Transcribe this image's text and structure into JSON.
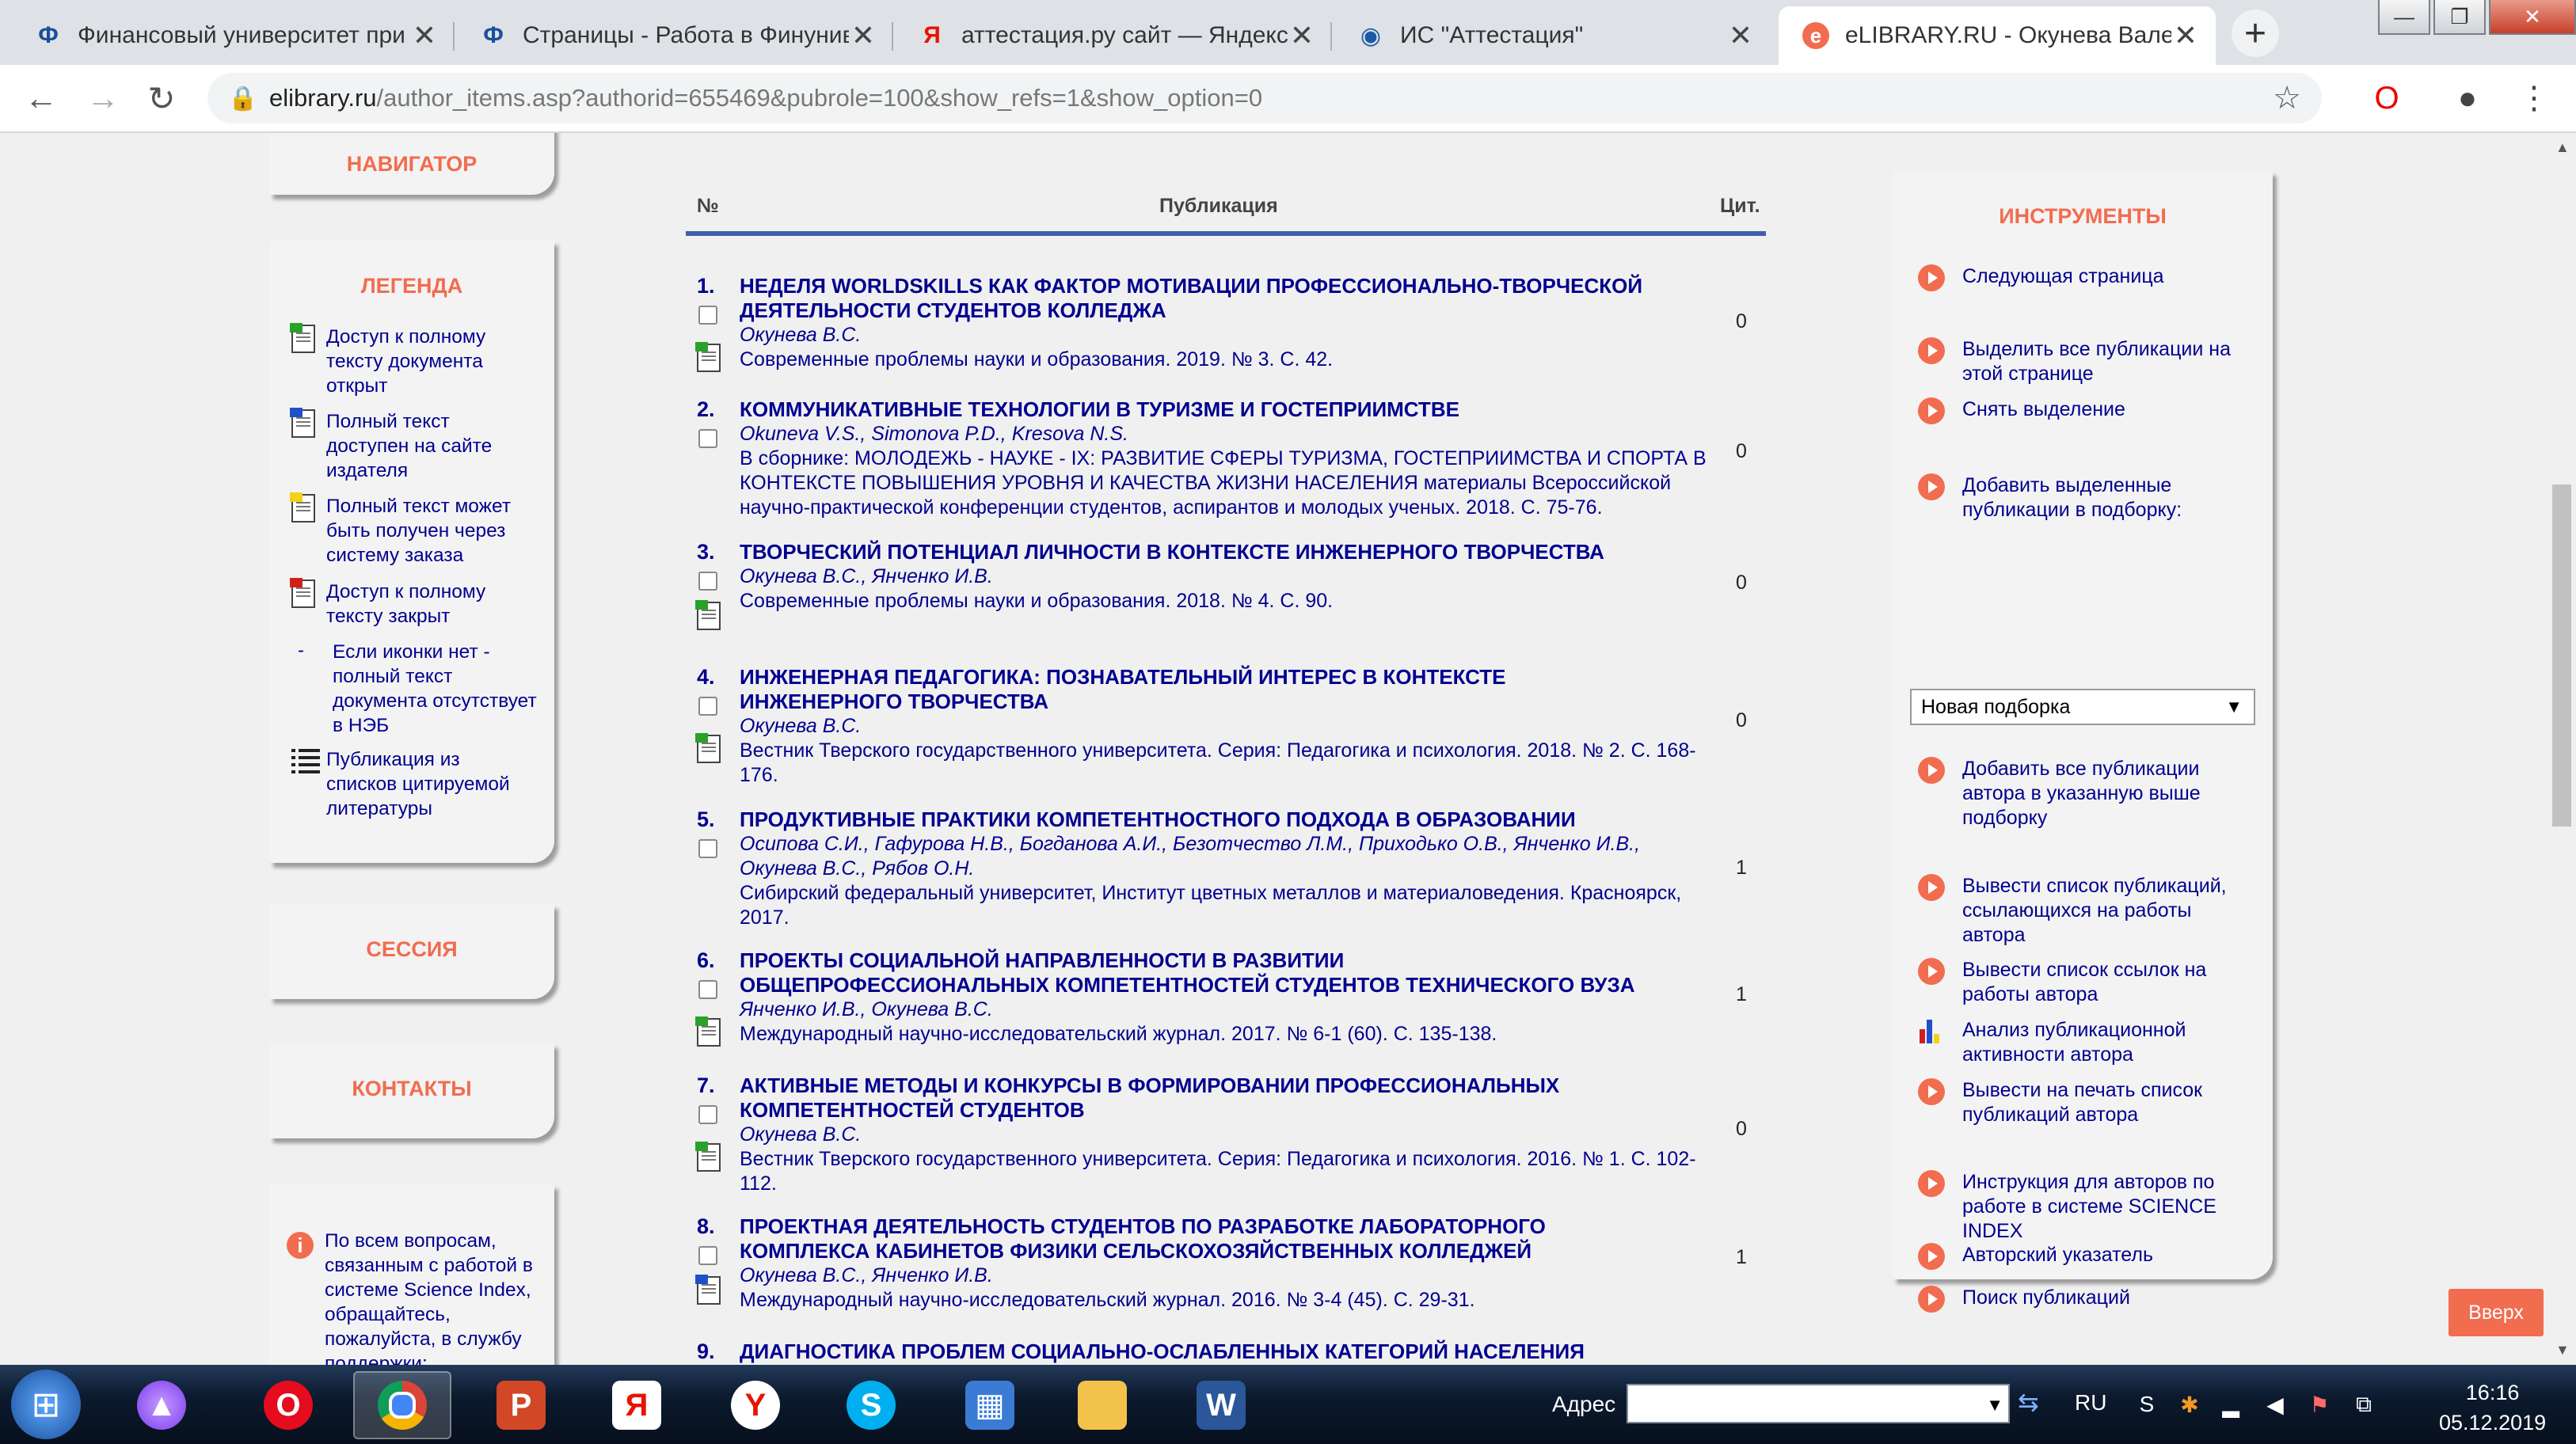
{
  "tabs": [
    {
      "title": "Финансовый университет при",
      "favicon": "Ф"
    },
    {
      "title": "Страницы - Работа в Финуниве",
      "favicon": "Ф"
    },
    {
      "title": "аттестация.ру сайт — Яндекс: н",
      "favicon": "Я"
    },
    {
      "title": "ИС \"Аттестация\"",
      "favicon": "◉"
    },
    {
      "title": "eLIBRARY.RU - Окунева Валент",
      "favicon": "e"
    }
  ],
  "url": {
    "host": "elibrary.ru",
    "path": "/author_items.asp?authorid=655469&pubrole=100&show_refs=1&show_option=0"
  },
  "navigator": {
    "title": "НАВИГАТОР"
  },
  "legend": {
    "title": "ЛЕГЕНДА",
    "items": [
      {
        "icon": "pdf-open-icon",
        "text": "Доступ к полному тексту документа открыт"
      },
      {
        "icon": "pdf-publisher-icon",
        "text": "Полный текст доступен на сайте издателя"
      },
      {
        "icon": "pdf-order-icon",
        "text": "Полный текст может быть получен через систему заказа"
      },
      {
        "icon": "pdf-closed-icon",
        "text": "Доступ к полному тексту закрыт"
      },
      {
        "icon": "dash",
        "text": "Если иконки нет - полный текст документа отсутствует в НЭБ"
      },
      {
        "icon": "list-icon",
        "text": "Публикация из списков цитируемой литературы"
      }
    ]
  },
  "session": {
    "title": "СЕССИЯ"
  },
  "contacts": {
    "title": "КОНТАКТЫ"
  },
  "help": {
    "text": "По всем вопросам, связанным с работой в системе Science Index, обращайтесь, пожалуйста, в службу поддержки:"
  },
  "table": {
    "col_num": "№",
    "col_pub": "Публикация",
    "col_cit": "Цит."
  },
  "publications": [
    {
      "num": "1.",
      "title": "НЕДЕЛЯ WORLDSKILLS КАК ФАКТОР МОТИВАЦИИ ПРОФЕССИОНАЛЬНО-ТВОРЧЕСКОЙ ДЕЯТЕЛЬНОСТИ СТУДЕНТОВ КОЛЛЕДЖА",
      "authors": "Окунева В.С.",
      "source": "Современные проблемы науки и образования. 2019. № 3. С. 42.",
      "cit": "0"
    },
    {
      "num": "2.",
      "title": "КОММУНИКАТИВНЫЕ ТЕХНОЛОГИИ В ТУРИЗМЕ И ГОСТЕПРИИМСТВЕ",
      "authors": "Okuneva V.S., Simonova P.D., Kresova N.S.",
      "source": "В сборнике: МОЛОДЕЖЬ - НАУКЕ - IX: РАЗВИТИЕ СФЕРЫ ТУРИЗМА, ГОСТЕПРИИМСТВА И СПОРТА В КОНТЕКСТЕ ПОВЫШЕНИЯ УРОВНЯ И КАЧЕСТВА ЖИЗНИ НАСЕЛЕНИЯ материалы Всероссийской научно-практической конференции студентов, аспирантов и молодых ученых. 2018. С. 75-76.",
      "cit": "0"
    },
    {
      "num": "3.",
      "title": "ТВОРЧЕСКИЙ ПОТЕНЦИАЛ ЛИЧНОСТИ В КОНТЕКСТЕ ИНЖЕНЕРНОГО ТВОРЧЕСТВА",
      "authors": "Окунева В.С., Янченко И.В.",
      "source": "Современные проблемы науки и образования. 2018. № 4. С. 90.",
      "cit": "0"
    },
    {
      "num": "4.",
      "title": "ИНЖЕНЕРНАЯ ПЕДАГОГИКА: ПОЗНАВАТЕЛЬНЫЙ ИНТЕРЕС В КОНТЕКСТЕ ИНЖЕНЕРНОГО ТВОРЧЕСТВА",
      "authors": "Окунева В.С.",
      "source": "Вестник Тверского государственного университета. Серия: Педагогика и психология. 2018. № 2. С. 168-176.",
      "cit": "0"
    },
    {
      "num": "5.",
      "title": "ПРОДУКТИВНЫЕ ПРАКТИКИ КОМПЕТЕНТНОСТНОГО ПОДХОДА В ОБРАЗОВАНИИ",
      "authors": "Осипова С.И., Гафурова Н.В., Богданова А.И., Безотчество Л.М., Приходько О.В., Янченко И.В., Окунева В.С., Рябов О.Н.",
      "source": "Сибирский федеральный университет, Институт цветных металлов и материаловедения. Красноярск, 2017.",
      "cit": "1"
    },
    {
      "num": "6.",
      "title": "ПРОЕКТЫ СОЦИАЛЬНОЙ НАПРАВЛЕННОСТИ В РАЗВИТИИ ОБЩЕПРОФЕССИОНАЛЬНЫХ КОМПЕТЕНТНОСТЕЙ СТУДЕНТОВ ТЕХНИЧЕСКОГО ВУЗА",
      "authors": "Янченко И.В., Окунева В.С.",
      "source": "Международный научно-исследовательский журнал. 2017. № 6-1 (60). С. 135-138.",
      "cit": "1"
    },
    {
      "num": "7.",
      "title": "АКТИВНЫЕ МЕТОДЫ И КОНКУРСЫ В ФОРМИРОВАНИИ ПРОФЕССИОНАЛЬНЫХ КОМПЕТЕНТНОСТЕЙ СТУДЕНТОВ",
      "authors": "Окунева В.С.",
      "source": "Вестник Тверского государственного университета. Серия: Педагогика и психология. 2016. № 1. С. 102-112.",
      "cit": "0"
    },
    {
      "num": "8.",
      "title": "ПРОЕКТНАЯ ДЕЯТЕЛЬНОСТЬ СТУДЕНТОВ ПО РАЗРАБОТКЕ ЛАБОРАТОРНОГО КОМПЛЕКСА КАБИНЕТОВ ФИЗИКИ СЕЛЬСКОХОЗЯЙСТВЕННЫХ КОЛЛЕДЖЕЙ",
      "authors": "Окунева В.С., Янченко И.В.",
      "source": "Международный научно-исследовательский журнал. 2016. № 3-4 (45). С. 29-31.",
      "cit": "1"
    },
    {
      "num": "9.",
      "title": "ДИАГНОСТИКА ПРОБЛЕМ СОЦИАЛЬНО-ОСЛАБЛЕННЫХ КАТЕГОРИЙ НАСЕЛЕНИЯ СТУДЕНТАМИ ТЕХНИЧЕСКОГО ВУЗА",
      "authors": "",
      "source": "",
      "cit": ""
    }
  ],
  "tools": {
    "title": "ИНСТРУМЕНТЫ",
    "items": [
      "Следующая страница",
      "Выделить все публикации на этой странице",
      "Снять выделение",
      "Добавить выделенные публикации в подборку:",
      "Добавить все публикации автора в указанную выше подборку",
      "Вывести список публикаций, ссылающихся на работы автора",
      "Вывести список ссылок на работы автора",
      "Анализ публикационной активности автора",
      "Вывести на печать список публикаций автора",
      "Инструкция для авторов по работе в системе SCIENCE INDEX",
      "Авторский указатель",
      "Поиск публикаций"
    ],
    "select_value": "Новая подборка"
  },
  "up_button": "Вверх",
  "taskbar": {
    "address_label": "Адрес",
    "lang": "RU",
    "time": "16:16",
    "date": "05.12.2019"
  },
  "colors": {
    "accent": "#f26c4f",
    "link": "#00008f",
    "rule": "#405fa9"
  }
}
